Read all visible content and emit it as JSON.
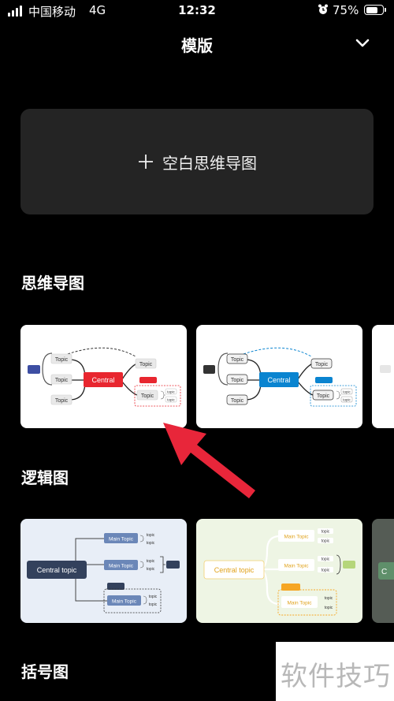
{
  "status_bar": {
    "carrier": "中国移动",
    "network": "4G",
    "time": "12:32",
    "battery_percent": "75%",
    "battery_level": 0.75,
    "icons": [
      "signal-icon",
      "alarm-icon",
      "battery-icon"
    ]
  },
  "header": {
    "title": "模版",
    "collapse_icon": "chevron-down-icon"
  },
  "blank_card": {
    "label": "空白思维导图",
    "icon": "plus-icon"
  },
  "sections": {
    "mindmap": {
      "title": "思维导图",
      "cards": [
        {
          "accent": "#e8262f",
          "central": "Central",
          "topics": [
            "Topic",
            "Topic",
            "Topic",
            "Topic",
            "Topic"
          ],
          "subtopics": [
            "topic",
            "topic"
          ]
        },
        {
          "accent": "#0a84d0",
          "central": "Central",
          "topics": [
            "Topic",
            "Topic",
            "Topic",
            "Topic",
            "Topic"
          ],
          "subtopics": [
            "topic",
            "topic"
          ]
        }
      ]
    },
    "logic": {
      "title": "逻辑图",
      "cards": [
        {
          "accent": "#6b87b8",
          "background": "#e8eef7",
          "central": "Central topic",
          "main_topics": [
            "Main Topic",
            "Main Topic",
            "Main Topic"
          ],
          "subtopics": [
            "topic",
            "topic",
            "topic",
            "topic",
            "topic",
            "topic"
          ]
        },
        {
          "accent": "#f6a623",
          "background": "#eef5e4",
          "central": "Central topic",
          "main_topics": [
            "Main Topic",
            "Main Topic",
            "Main Topic"
          ],
          "subtopics": [
            "topic",
            "topic",
            "topic",
            "topic",
            "topic",
            "topic"
          ]
        }
      ]
    },
    "bracket": {
      "title": "括号图"
    }
  },
  "watermark": "软件技巧",
  "annotation_color": "#e8263a"
}
